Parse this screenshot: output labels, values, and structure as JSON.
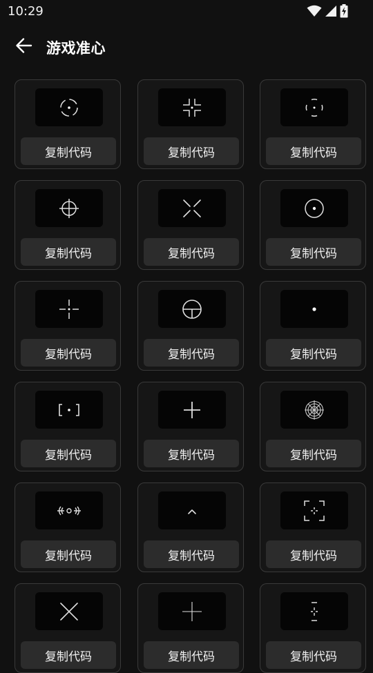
{
  "status": {
    "time": "10:29"
  },
  "header": {
    "title": "游戏准心"
  },
  "cards": [
    {
      "copy_label": "复制代码",
      "icon": "dot-circle-dashed-crosshair-icon"
    },
    {
      "copy_label": "复制代码",
      "icon": "corner-brackets-dot-crosshair-icon"
    },
    {
      "copy_label": "复制代码",
      "icon": "split-circle-dot-crosshair-icon"
    },
    {
      "copy_label": "复制代码",
      "icon": "circle-cross-crosshair-icon"
    },
    {
      "copy_label": "复制代码",
      "icon": "x-gap-crosshair-icon"
    },
    {
      "copy_label": "复制代码",
      "icon": "ring-dot-crosshair-icon"
    },
    {
      "copy_label": "复制代码",
      "icon": "small-cross-dot-crosshair-icon"
    },
    {
      "copy_label": "复制代码",
      "icon": "circle-t-crosshair-icon"
    },
    {
      "copy_label": "复制代码",
      "icon": "single-dot-crosshair-icon"
    },
    {
      "copy_label": "复制代码",
      "icon": "square-brackets-dot-crosshair-icon"
    },
    {
      "copy_label": "复制代码",
      "icon": "plus-crosshair-icon"
    },
    {
      "copy_label": "复制代码",
      "icon": "sniper-scope-crosshair-icon"
    },
    {
      "copy_label": "复制代码",
      "icon": "parentheses-ring-crosshair-icon"
    },
    {
      "copy_label": "复制代码",
      "icon": "chevron-up-crosshair-icon"
    },
    {
      "copy_label": "复制代码",
      "icon": "frame-corners-cross-crosshair-icon"
    },
    {
      "copy_label": "复制代码",
      "icon": "x-cross-crosshair-icon"
    },
    {
      "copy_label": "复制代码",
      "icon": "thin-plus-crosshair-icon"
    },
    {
      "copy_label": "复制代码",
      "icon": "dashes-cross-crosshair-icon"
    }
  ]
}
